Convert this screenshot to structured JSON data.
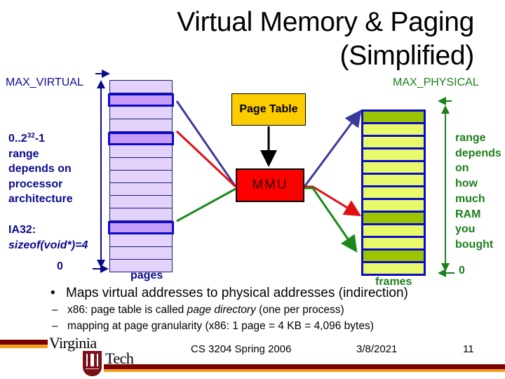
{
  "slide": {
    "title_line1": "Virtual Memory & Paging",
    "title_line2": "(Simplified)"
  },
  "diagram": {
    "max_virtual_label": "MAX_VIRTUAL",
    "max_physical_label": "MAX_PHYSICAL",
    "virtual_range": {
      "base": "0..2",
      "exponent": "32",
      "suffix": "-1",
      "lines": [
        "range",
        "depends on",
        "processor",
        "architecture"
      ]
    },
    "ia32_label": "IA32:",
    "sizeof_label": "sizeof(void*)=4",
    "zero_left": "0",
    "zero_right": "0",
    "pages_label": "pages",
    "frames_label": "frames",
    "page_table_label": "Page Table",
    "mmu_label": "MMU",
    "physical_range_lines": [
      "range",
      "depends",
      "on",
      "how",
      "much",
      "RAM",
      "you",
      "bought"
    ],
    "virtual_pages": {
      "count": 15,
      "highlighted_rows": [
        1,
        4,
        11
      ]
    },
    "physical_frames": {
      "count": 13,
      "highlighted_rows": [
        0,
        8,
        11
      ]
    },
    "mappings": [
      {
        "virtual_row": 1,
        "physical_row": 0,
        "color": "#3a3a9a"
      },
      {
        "virtual_row": 4,
        "physical_row": 8,
        "color": "#e01010"
      },
      {
        "virtual_row": 11,
        "physical_row": 11,
        "color": "#1a8a1a"
      }
    ],
    "colors": {
      "virtual_text": "#0a0a8c",
      "physical_text": "#1d7f1d",
      "page_table_fill": "#fccc00",
      "mmu_fill": "#ff0000"
    }
  },
  "bullets": {
    "main": "Maps virtual addresses to physical addresses (indirection)",
    "bullet_symbol": "•",
    "dash_symbol": "–",
    "sub1_pre": "x86: page table is called ",
    "sub1_italic": "page directory",
    "sub1_post": " (one per process)",
    "sub2": "mapping at page granularity (x86: 1 page = 4 KB = 4,096 bytes)"
  },
  "footer": {
    "logo_word1": "Virginia",
    "logo_word2": "Tech",
    "course": "CS 3204 Spring 2006",
    "date": "3/8/2021",
    "page_number": "11",
    "colors": {
      "maroon": "#7b0000",
      "orange": "#f4a020"
    }
  }
}
